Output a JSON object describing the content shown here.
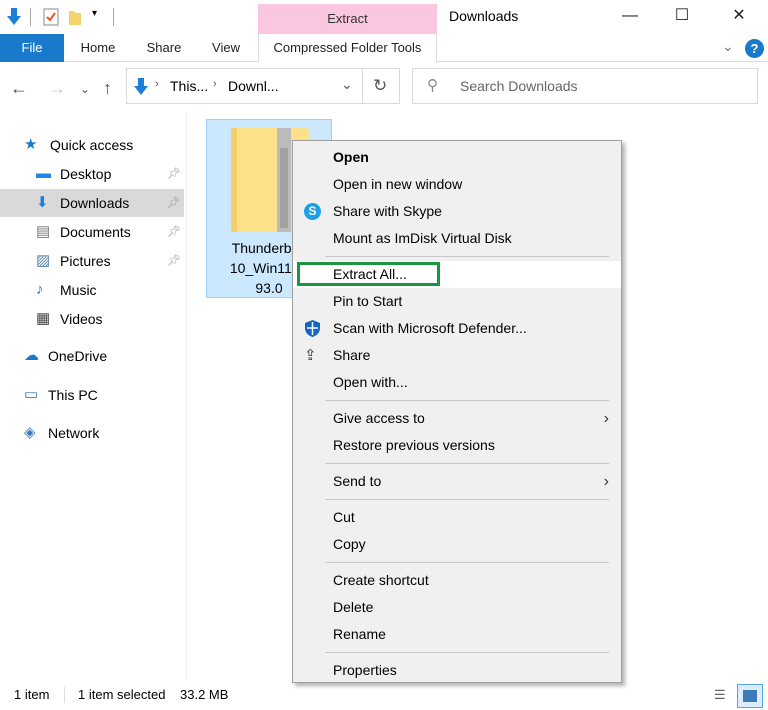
{
  "window": {
    "title": "Downloads",
    "context_tab": "Extract"
  },
  "ribbon": {
    "tabs": [
      "File",
      "Home",
      "Share",
      "View",
      "Compressed Folder Tools"
    ]
  },
  "address": {
    "segments": [
      "This...",
      "Downl..."
    ]
  },
  "search": {
    "placeholder": "Search Downloads"
  },
  "sidebar": {
    "items": [
      {
        "label": "Quick access",
        "icon": "star-icon"
      },
      {
        "label": "Desktop",
        "icon": "desktop-icon",
        "pinned": true
      },
      {
        "label": "Downloads",
        "icon": "download-icon",
        "pinned": true,
        "selected": true
      },
      {
        "label": "Documents",
        "icon": "documents-icon",
        "pinned": true
      },
      {
        "label": "Pictures",
        "icon": "pictures-icon",
        "pinned": true
      },
      {
        "label": "Music",
        "icon": "music-icon"
      },
      {
        "label": "Videos",
        "icon": "videos-icon"
      },
      {
        "label": "OneDrive",
        "icon": "cloud-icon"
      },
      {
        "label": "This PC",
        "icon": "pc-icon"
      },
      {
        "label": "Network",
        "icon": "network-icon"
      }
    ]
  },
  "file": {
    "name_lines": [
      "Thunderbolt",
      "10_Win11-1.",
      "93.0"
    ]
  },
  "context_menu": {
    "items": [
      {
        "label": "Open",
        "bold": true
      },
      {
        "label": "Open in new window"
      },
      {
        "label": "Share with Skype",
        "icon": "skype-icon"
      },
      {
        "label": "Mount as ImDisk Virtual Disk"
      },
      {
        "sep": true
      },
      {
        "label": "Extract All...",
        "highlight": true
      },
      {
        "label": "Pin to Start"
      },
      {
        "label": "Scan with Microsoft Defender...",
        "icon": "defender-icon"
      },
      {
        "label": "Share",
        "icon": "share-icon"
      },
      {
        "label": "Open with..."
      },
      {
        "sep": true
      },
      {
        "label": "Give access to",
        "submenu": true
      },
      {
        "label": "Restore previous versions"
      },
      {
        "sep": true
      },
      {
        "label": "Send to",
        "submenu": true
      },
      {
        "sep": true
      },
      {
        "label": "Cut"
      },
      {
        "label": "Copy"
      },
      {
        "sep": true
      },
      {
        "label": "Create shortcut"
      },
      {
        "label": "Delete"
      },
      {
        "label": "Rename"
      },
      {
        "sep": true
      },
      {
        "label": "Properties"
      }
    ]
  },
  "status": {
    "count": "1 item",
    "selected": "1 item selected",
    "size": "33.2 MB"
  },
  "colors": {
    "accent": "#1979ca",
    "context_tab": "#fbc6df",
    "selection": "#cce8ff",
    "highlight_box": "#1a9641"
  }
}
